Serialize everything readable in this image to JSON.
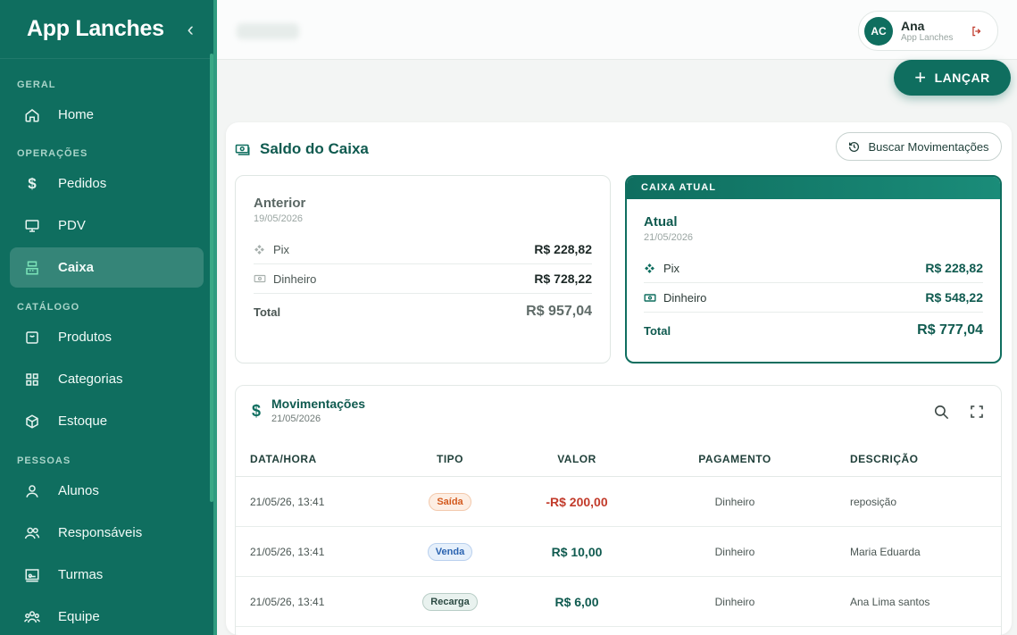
{
  "app": {
    "title": "App Lanches",
    "collapse_icon": "chevron-left-icon"
  },
  "sidebar": {
    "sections": [
      {
        "label": "GERAL",
        "items": [
          {
            "label": "Home",
            "icon": "home-icon"
          }
        ]
      },
      {
        "label": "OPERAÇÕES",
        "items": [
          {
            "label": "Pedidos",
            "icon": "dollar-icon"
          },
          {
            "label": "PDV",
            "icon": "monitor-icon"
          },
          {
            "label": "Caixa",
            "icon": "cash-register-icon",
            "active": true
          }
        ]
      },
      {
        "label": "CATÁLOGO",
        "items": [
          {
            "label": "Produtos",
            "icon": "product-icon"
          },
          {
            "label": "Categorias",
            "icon": "grid-icon"
          },
          {
            "label": "Estoque",
            "icon": "box-icon"
          }
        ]
      },
      {
        "label": "PESSOAS",
        "items": [
          {
            "label": "Alunos",
            "icon": "user-icon"
          },
          {
            "label": "Responsáveis",
            "icon": "users-icon"
          },
          {
            "label": "Turmas",
            "icon": "class-icon"
          },
          {
            "label": "Equipe",
            "icon": "team-icon"
          }
        ]
      }
    ]
  },
  "user": {
    "initials": "AC",
    "name": "Ana",
    "subtitle": "App Lanches",
    "logout_icon": "logout-icon"
  },
  "actions": {
    "launch_label": "LANÇAR"
  },
  "caixa": {
    "title": "Saldo do Caixa",
    "search_button": "Buscar Movimentações",
    "anterior": {
      "title": "Anterior",
      "date": "19/05/2026",
      "pix_label": "Pix",
      "pix_value": "R$ 228,82",
      "dinheiro_label": "Dinheiro",
      "dinheiro_value": "R$ 728,22",
      "total_label": "Total",
      "total_value": "R$ 957,04"
    },
    "atual": {
      "banner": "CAIXA ATUAL",
      "title": "Atual",
      "date": "21/05/2026",
      "pix_label": "Pix",
      "pix_value": "R$ 228,82",
      "dinheiro_label": "Dinheiro",
      "dinheiro_value": "R$ 548,22",
      "total_label": "Total",
      "total_value": "R$ 777,04"
    }
  },
  "movimentacoes": {
    "title": "Movimentações",
    "date": "21/05/2026",
    "columns": [
      "DATA/HORA",
      "TIPO",
      "VALOR",
      "PAGAMENTO",
      "DESCRIÇÃO"
    ],
    "rows": [
      {
        "datetime": "21/05/26, 13:41",
        "tipo": "Saída",
        "valor": "-R$ 200,00",
        "pagamento": "Dinheiro",
        "descricao": "reposição"
      },
      {
        "datetime": "21/05/26, 13:41",
        "tipo": "Venda",
        "valor": "R$ 10,00",
        "pagamento": "Dinheiro",
        "descricao": "Maria Eduarda"
      },
      {
        "datetime": "21/05/26, 13:41",
        "tipo": "Recarga",
        "valor": "R$ 6,00",
        "pagamento": "Dinheiro",
        "descricao": "Ana Lima santos"
      }
    ]
  },
  "colors": {
    "primary": "#0f6e5f",
    "negative": "#c23b2b"
  }
}
